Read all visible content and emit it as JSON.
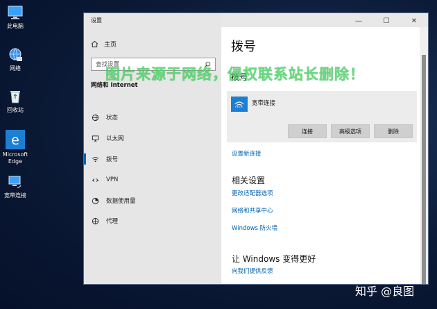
{
  "desktop": {
    "icons": [
      {
        "label": "此电脑",
        "icon": "computer-icon"
      },
      {
        "label": "网络",
        "icon": "network-globe-icon"
      },
      {
        "label": "回收站",
        "icon": "recycle-bin-icon"
      },
      {
        "label": "Microsoft Edge",
        "icon": "edge-icon"
      },
      {
        "label": "宽带连接",
        "icon": "broadband-connection-icon"
      }
    ]
  },
  "window": {
    "title": "设置",
    "controls": {
      "minimize": "—",
      "maximize": "☐",
      "close": "✕"
    }
  },
  "sidebar": {
    "home_label": "主页",
    "search_placeholder": "查找设置",
    "section_title": "网络和 Internet",
    "items": [
      {
        "label": "状态",
        "icon": "status-icon",
        "active": false
      },
      {
        "label": "以太网",
        "icon": "ethernet-icon",
        "active": false
      },
      {
        "label": "拨号",
        "icon": "dialup-icon",
        "active": true
      },
      {
        "label": "VPN",
        "icon": "vpn-icon",
        "active": false
      },
      {
        "label": "数据使用量",
        "icon": "data-usage-icon",
        "active": false
      },
      {
        "label": "代理",
        "icon": "proxy-icon",
        "active": false
      }
    ]
  },
  "main": {
    "title": "拨号",
    "subtitle": "拨号",
    "connection": {
      "name": "宽带连接",
      "buttons": {
        "connect": "连接",
        "advanced": "高级选项",
        "delete": "删除"
      }
    },
    "setup_link": "设置新连接",
    "related_title": "相关设置",
    "related_links": [
      "更改适配器选项",
      "网络和共享中心",
      "Windows 防火墙"
    ],
    "improve_title": "让 Windows 变得更好",
    "feedback_link": "向我们提供反馈"
  },
  "overlay": {
    "watermark": "图片来源于网络，侵权联系站长删除！",
    "attribution": "知乎 @良图"
  },
  "colors": {
    "accent": "#0063b1",
    "watermark": "#4fd46a",
    "desktop_bg": "#0b1a36"
  }
}
